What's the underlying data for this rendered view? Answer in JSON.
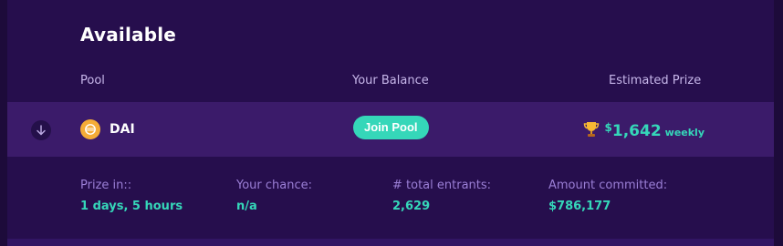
{
  "section": {
    "title": "Available"
  },
  "columns": {
    "pool": "Pool",
    "balance": "Your Balance",
    "prize": "Estimated Prize"
  },
  "pool": {
    "name": "DAI",
    "join_label": "Join Pool",
    "prize_currency": "$",
    "prize_amount": "1,642",
    "prize_period": "weekly"
  },
  "stats": [
    {
      "label": "Prize in::",
      "value": "1 days, 5 hours"
    },
    {
      "label": "Your chance:",
      "value": "n/a"
    },
    {
      "label": "# total entrants:",
      "value": "2,629"
    },
    {
      "label": "Amount committed:",
      "value": "$786,177"
    }
  ],
  "icons": {
    "expand": "arrow-down-icon",
    "coin": "dai-coin-icon",
    "trophy": "trophy-icon"
  },
  "colors": {
    "accent": "#35d7b9",
    "row": "#3b1b6a",
    "panel": "#260e4d",
    "label": "#9b7fd6"
  }
}
